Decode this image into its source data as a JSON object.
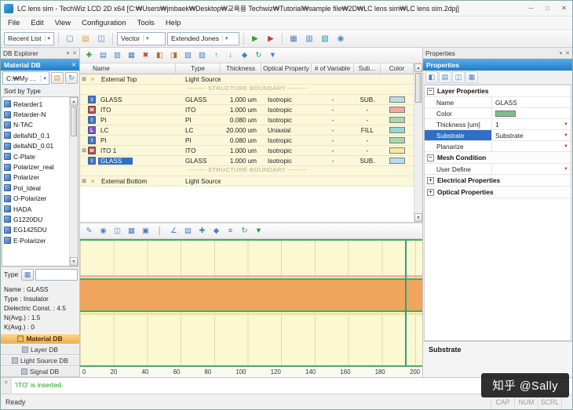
{
  "window": {
    "title": "LC lens sim - TechWiz LCD 2D x64 [C:₩Users₩jmbaek₩Desktop₩교육용 Techwiz₩Tutorial₩sample file₩2D₩LC lens sim₩LC lens sim.2dpj]",
    "minimize": "─",
    "maximize": "□",
    "close": "✕"
  },
  "menu": {
    "items": [
      "File",
      "Edit",
      "View",
      "Configuration",
      "Tools",
      "Help"
    ]
  },
  "toolbar": {
    "recent_list": "Recent List",
    "vector": "Vector",
    "method": "Extended Jones",
    "file_icons": [
      {
        "name": "new-file-icon",
        "glyph": "▢",
        "color": "#4a7fc1"
      },
      {
        "name": "open-file-icon",
        "glyph": "▤",
        "color": "#d9a23c"
      },
      {
        "name": "save-file-icon",
        "glyph": "◫",
        "color": "#4a7fc1"
      }
    ],
    "run_icons": [
      {
        "name": "run-icon",
        "glyph": "▶",
        "color": "#2e9e3e"
      },
      {
        "name": "run-all-icon",
        "glyph": "▶",
        "color": "#cc3b3b"
      }
    ],
    "analysis_icons": [
      {
        "name": "result-table-icon",
        "glyph": "▦",
        "color": "#4a7fc1"
      },
      {
        "name": "result-graph-icon",
        "glyph": "▥",
        "color": "#4a7fc1"
      },
      {
        "name": "report-icon",
        "glyph": "▧",
        "color": "#2e8e9e"
      },
      {
        "name": "info-icon",
        "glyph": "◉",
        "color": "#4a7fc1"
      }
    ]
  },
  "db_explorer": {
    "caption": "DB Explorer",
    "header": "Material DB",
    "path_value": "C:₩My Tech",
    "sort_label": "Sort by Type",
    "materials": [
      "Retarder1",
      "Retarder-N",
      "N-TAC",
      "deltaND_0.1",
      "deltaND_0.01",
      "C-Plate",
      "Polarizer_real",
      "Polarizer",
      "Pol_Ideal",
      "O-Polarizer",
      "HADA",
      "G1220DU",
      "EG1425DU",
      "E-Polarizer"
    ],
    "type_label": "Type",
    "info_lines": [
      "Name : GLASS",
      "Type : Insulator",
      "Dielectric Const. : 4.5",
      "N(Avg.) : 1.5",
      "K(Avg.) : 0"
    ],
    "tabs": [
      {
        "label": "Material DB",
        "selected": "true"
      },
      {
        "label": "Layer DB",
        "selected": "false"
      },
      {
        "label": "Light Source DB",
        "selected": "false"
      },
      {
        "label": "Signal DB",
        "selected": "false"
      }
    ]
  },
  "layer_toolbar_icons": [
    {
      "name": "add-layer-icon",
      "glyph": "✚",
      "color": "#2e9e3e"
    },
    {
      "name": "insert-above-icon",
      "glyph": "▤",
      "color": "#4a7fc1"
    },
    {
      "name": "insert-below-icon",
      "glyph": "▥",
      "color": "#4a7fc1"
    },
    {
      "name": "copy-layer-icon",
      "glyph": "▦",
      "color": "#4a7fc1"
    },
    {
      "name": "delete-layer-icon",
      "glyph": "✖",
      "color": "#cc3b3b"
    },
    {
      "name": "split-layer-icon",
      "glyph": "◧",
      "color": "#b06a2a"
    },
    {
      "name": "merge-layer-icon",
      "glyph": "◨",
      "color": "#b06a2a"
    },
    {
      "name": "pattern-layer-icon",
      "glyph": "▧",
      "color": "#4a7fc1"
    },
    {
      "name": "mask-layer-icon",
      "glyph": "▨",
      "color": "#4a7fc1"
    },
    {
      "name": "move-up-icon",
      "glyph": "↑",
      "color": "#2e9e3e"
    },
    {
      "name": "move-down-icon",
      "glyph": "↓",
      "color": "#2e9e3e"
    },
    {
      "name": "anchor-icon",
      "glyph": "◆",
      "color": "#4a7fc1"
    },
    {
      "name": "refresh-icon",
      "glyph": "↻",
      "color": "#2e8e9e"
    },
    {
      "name": "apply-down-icon",
      "glyph": "▼",
      "color": "#4a7fc1"
    }
  ],
  "layer_table": {
    "columns": [
      "Name",
      "Type",
      "Thickness",
      "Optical Property",
      "# of Variable",
      "Sub...",
      "Color"
    ],
    "boundary_text": "-------- STRUCTURE BOUNDARY --------",
    "external_top": {
      "name": "External Top",
      "type": "Light Source"
    },
    "external_bottom": {
      "name": "External Bottom",
      "type": "Light Source"
    },
    "rows": [
      {
        "expander": "",
        "icon": "I",
        "icon_color": "#4a78c0",
        "name": "GLASS",
        "type": "GLASS",
        "thickness": "1.000 um",
        "optical": "Isotropic",
        "variables": "-",
        "sub": "SUB.",
        "color": "#b8dcea",
        "selected": "false"
      },
      {
        "expander": "",
        "icon": "M",
        "icon_color": "#a85454",
        "name": "ITO",
        "type": "ITO",
        "thickness": "1.000 um",
        "optical": "Isotropic",
        "variables": "-",
        "sub": "-",
        "color": "#f2a8a0",
        "selected": "false"
      },
      {
        "expander": "",
        "icon": "I",
        "icon_color": "#4a78c0",
        "name": "PI",
        "type": "PI",
        "thickness": "0.080 um",
        "optical": "Isotropic",
        "variables": "-",
        "sub": "-",
        "color": "#a8d8a8",
        "selected": "false"
      },
      {
        "expander": "",
        "icon": "L",
        "icon_color": "#7a5ac0",
        "name": "LC",
        "type": "LC",
        "thickness": "20.000 um",
        "optical": "Uniaxial",
        "variables": "-",
        "sub": "FILL",
        "color": "#96d8d0",
        "selected": "false"
      },
      {
        "expander": "",
        "icon": "I",
        "icon_color": "#4a78c0",
        "name": "PI",
        "type": "PI",
        "thickness": "0.080 um",
        "optical": "Isotropic",
        "variables": "-",
        "sub": "-",
        "color": "#a8d8a8",
        "selected": "false"
      },
      {
        "expander": "⊞",
        "icon": "M",
        "icon_color": "#a85454",
        "name": "ITO 1",
        "type": "ITO",
        "thickness": "1.000 um",
        "optical": "Isotropic",
        "variables": "-",
        "sub": "-",
        "color": "#f0eca0",
        "selected": "false"
      },
      {
        "expander": "",
        "icon": "I",
        "icon_color": "#4a78c0",
        "name": "GLASS",
        "type": "GLASS",
        "thickness": "1.000 um",
        "optical": "Isotropic",
        "variables": "-",
        "sub": "SUB.",
        "color": "#b8dcea",
        "selected": "true"
      }
    ],
    "external_expander": "⊞"
  },
  "view_toolbar_icons": [
    {
      "name": "edit-icon",
      "glyph": "✎",
      "color": "#4a7fc1"
    },
    {
      "name": "zoom-icon",
      "glyph": "◉",
      "color": "#4a7fc1"
    },
    {
      "name": "zoom-window-icon",
      "glyph": "◫",
      "color": "#4a7fc1"
    },
    {
      "name": "grid-toggle-icon",
      "glyph": "▦",
      "color": "#4a7fc1"
    },
    {
      "name": "fit-view-icon",
      "glyph": "▣",
      "color": "#4a7fc1"
    },
    {
      "name": "ruler-icon",
      "glyph": "│",
      "color": "#888888"
    },
    {
      "name": "angle-icon",
      "glyph": "∠",
      "color": "#4a7fc1"
    },
    {
      "name": "layers-view-icon",
      "glyph": "▤",
      "color": "#4a7fc1"
    },
    {
      "name": "axes-icon",
      "glyph": "✚",
      "color": "#2e8e9e"
    },
    {
      "name": "snap-icon",
      "glyph": "◆",
      "color": "#4a7fc1"
    },
    {
      "name": "legend-icon",
      "glyph": "≡",
      "color": "#4a7fc1"
    },
    {
      "name": "redraw-icon",
      "glyph": "↻",
      "color": "#2e8e9e"
    },
    {
      "name": "export-view-icon",
      "glyph": "▼",
      "color": "#2e9e3e"
    }
  ],
  "plot": {
    "x_ticks": [
      "0",
      "20",
      "40",
      "60",
      "80",
      "100",
      "120",
      "140",
      "160",
      "180",
      "200"
    ],
    "lc_band_color": "#f0a55c",
    "boundary_line_color": "#3fae5e"
  },
  "properties": {
    "caption": "Properties",
    "header": "Properties",
    "toolbar_icons": [
      {
        "name": "categorized-icon",
        "glyph": "◧"
      },
      {
        "name": "alphabetical-icon",
        "glyph": "▤"
      },
      {
        "name": "property-pages-icon",
        "glyph": "◫"
      },
      {
        "name": "pin-panel-icon",
        "glyph": "▦"
      }
    ],
    "sections": {
      "layer": "Layer Properties",
      "mesh": "Mesh Condition",
      "electrical": "Electrical Properties",
      "optical": "Optical Properties"
    },
    "fields": {
      "name_label": "Name",
      "name_value": "GLASS",
      "color_label": "Color",
      "color_value": "#7cbf8e",
      "thickness_label": "Thickness [um]",
      "thickness_value": "1",
      "substrate_label": "Substrate",
      "substrate_value": "Substrate",
      "planarize_label": "Planarize",
      "planarize_value": "",
      "user_define_label": "User Define",
      "user_define_value": ""
    },
    "footer": "Substrate"
  },
  "output": {
    "close": "✕",
    "message": "'ITO' is inserted."
  },
  "status": {
    "ready": "Ready",
    "flags": [
      "CAP",
      "NUM",
      "SCRL"
    ]
  },
  "watermark": {
    "text": "知乎 @Sally"
  }
}
